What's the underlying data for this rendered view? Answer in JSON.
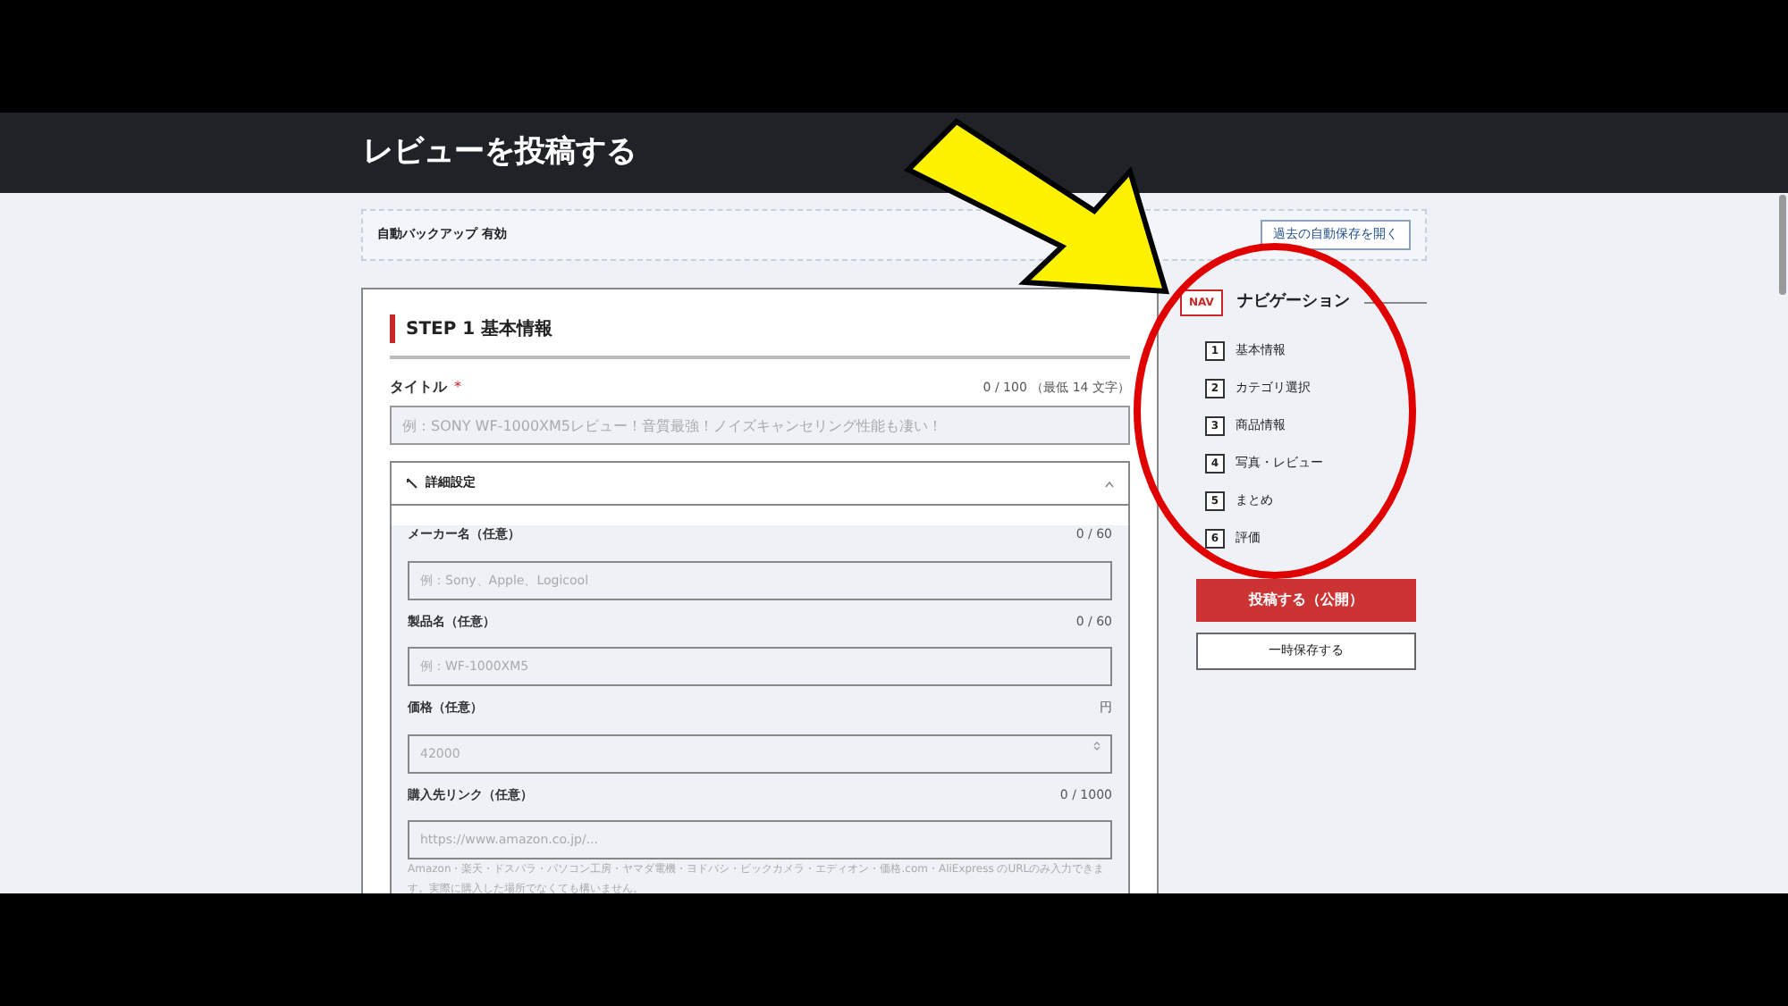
{
  "header": {
    "title": "レビューを投稿する"
  },
  "backup": {
    "status": "自動バックアップ 有効",
    "button": "過去の自動保存を開く"
  },
  "step": {
    "number": "STEP 1",
    "title": "基本情報"
  },
  "title_field": {
    "label": "タイトル",
    "required_mark": "*",
    "counter": "0 / 100 （最低 14 文字）",
    "placeholder": "例：SONY WF-1000XM5レビュー！音質最強！ノイズキャンセリング性能も凄い！"
  },
  "details": {
    "label": "詳細設定",
    "expanded": true,
    "fields": [
      {
        "kind": "text",
        "label": "メーカー名（任意）",
        "counter": "0 / 60",
        "placeholder": "例：Sony、Apple、Logicool"
      },
      {
        "kind": "text",
        "label": "製品名（任意）",
        "counter": "0 / 60",
        "placeholder": "例：WF-1000XM5"
      },
      {
        "kind": "number",
        "label": "価格（任意）",
        "counter": "円",
        "placeholder": "42000"
      },
      {
        "kind": "text",
        "label": "購入先リンク（任意）",
        "counter": "0 / 1000",
        "placeholder": "https://www.amazon.co.jp/...",
        "note": "Amazon・楽天・ドスパラ・パソコン工房・ヤマダ電機・ヨドバシ・ビックカメラ・エディオン・価格.com・AliExpress のURLのみ入力できます。実際に購入した場所でなくても構いません。"
      }
    ]
  },
  "nav": {
    "badge": "NAV",
    "title": "ナビゲーション",
    "items": [
      {
        "number": "1",
        "label": "基本情報"
      },
      {
        "number": "2",
        "label": "カテゴリ選択"
      },
      {
        "number": "3",
        "label": "商品情報"
      },
      {
        "number": "4",
        "label": "写真・レビュー"
      },
      {
        "number": "5",
        "label": "まとめ"
      },
      {
        "number": "6",
        "label": "評価"
      }
    ]
  },
  "buttons": {
    "publish": "投稿する（公開）",
    "save": "一時保存する"
  }
}
